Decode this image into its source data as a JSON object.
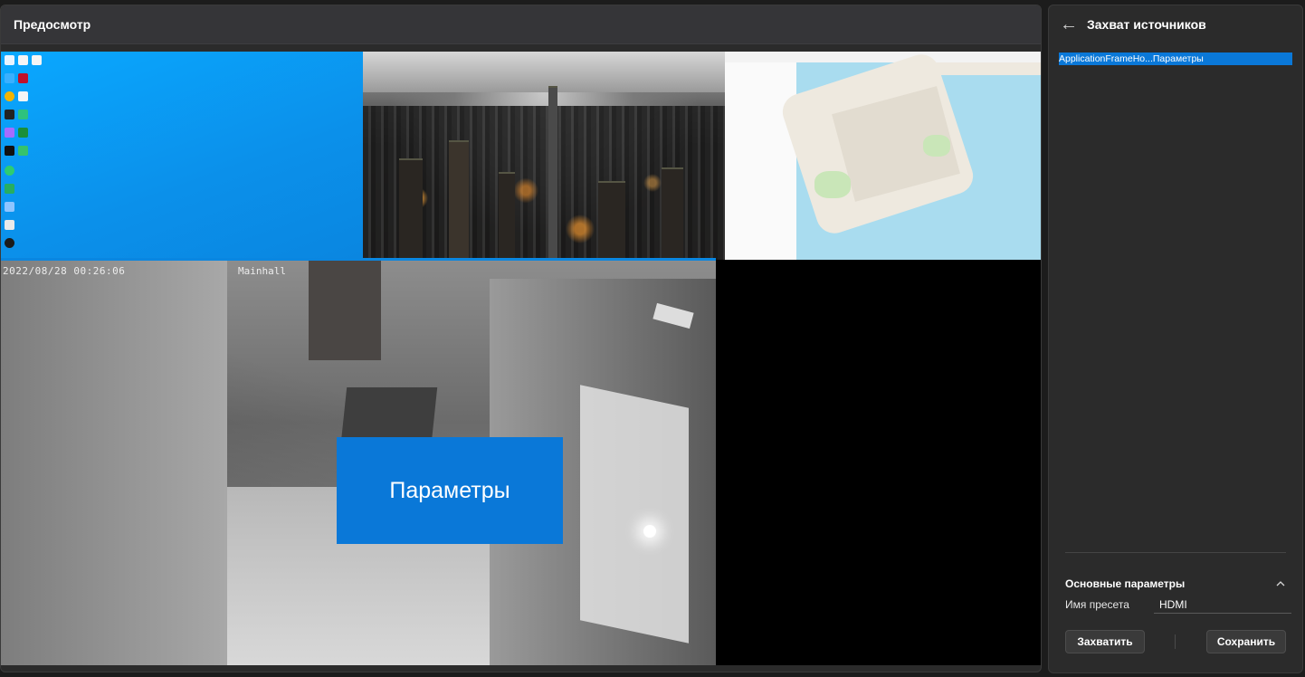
{
  "preview": {
    "title": "Предосмотр",
    "camera": {
      "timestamp": "2022/08/28 00:26:06",
      "location_label": "Mainhall"
    },
    "overlay_label": "Параметры"
  },
  "sidebar": {
    "title": "Захват источников",
    "back_icon": "arrow-left-icon",
    "sources": [
      {
        "label": "ApplicationFrameHo...Параметры",
        "selected": true
      }
    ],
    "section": {
      "title": "Основные параметры",
      "expanded": true,
      "icon": "chevron-up-icon"
    },
    "preset": {
      "label": "Имя пресета",
      "value": "HDMI"
    },
    "buttons": {
      "capture": "Захватить",
      "save": "Сохранить"
    }
  },
  "colors": {
    "accent": "#0a78d8",
    "panel": "#2b2b2b",
    "background": "#1c1c1c"
  }
}
